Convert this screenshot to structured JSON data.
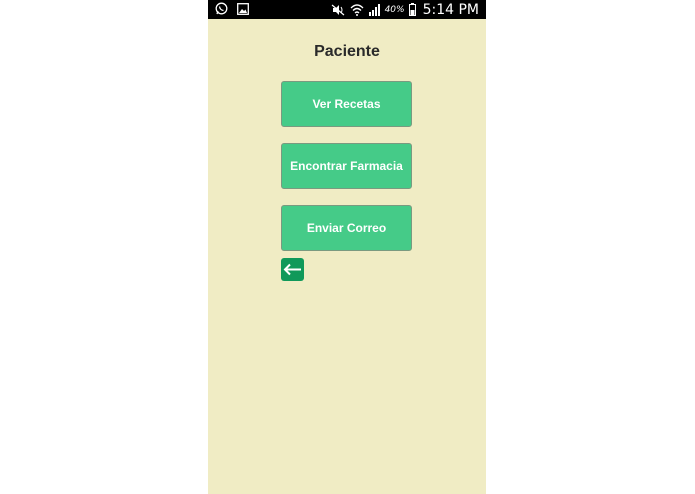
{
  "status_bar": {
    "battery_percent": "40%",
    "time": "5:14 PM",
    "icons": [
      "whatsapp-icon",
      "gallery-icon",
      "mute-icon",
      "wifi-icon",
      "signal-icon",
      "battery-icon"
    ]
  },
  "screen": {
    "title": "Paciente",
    "buttons": [
      {
        "label": "Ver Recetas"
      },
      {
        "label": "Encontrar Farmacia"
      },
      {
        "label": "Enviar Correo"
      }
    ],
    "back_icon": "back-arrow-icon"
  },
  "colors": {
    "background": "#f0ecc4",
    "button": "#45cb88",
    "back_button": "#10995a",
    "status_bar": "#000000"
  }
}
